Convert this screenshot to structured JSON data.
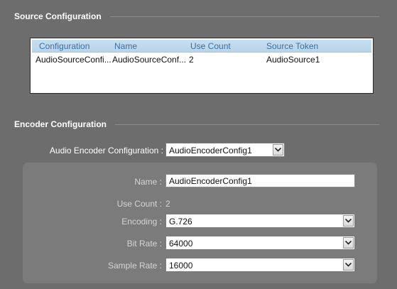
{
  "source_config": {
    "title": "Source Configuration",
    "columns": [
      "Configuration",
      "Name",
      "Use Count",
      "Source Token"
    ],
    "rows": [
      [
        "AudioSourceConfi...",
        "AudioSourceConf...",
        "2",
        "AudioSource1"
      ]
    ]
  },
  "encoder_config": {
    "title": "Encoder Configuration",
    "selector_label": "Audio Encoder Configuration :",
    "selector_value": "AudioEncoderConfig1",
    "name_label": "Name :",
    "name_value": "AudioEncoderConfig1",
    "use_count_label": "Use Count :",
    "use_count_value": "2",
    "encoding_label": "Encoding :",
    "encoding_value": "G.726",
    "bitrate_label": "Bit Rate :",
    "bitrate_value": "64000",
    "samplerate_label": "Sample Rate :",
    "samplerate_value": "16000"
  },
  "icons": {
    "dropdown": "chevron-down-icon"
  },
  "colors": {
    "background": "#6d6d6d",
    "panel": "#7b7b7b",
    "table_header": "#c6def1",
    "table_header_text": "#3a6ea5"
  }
}
